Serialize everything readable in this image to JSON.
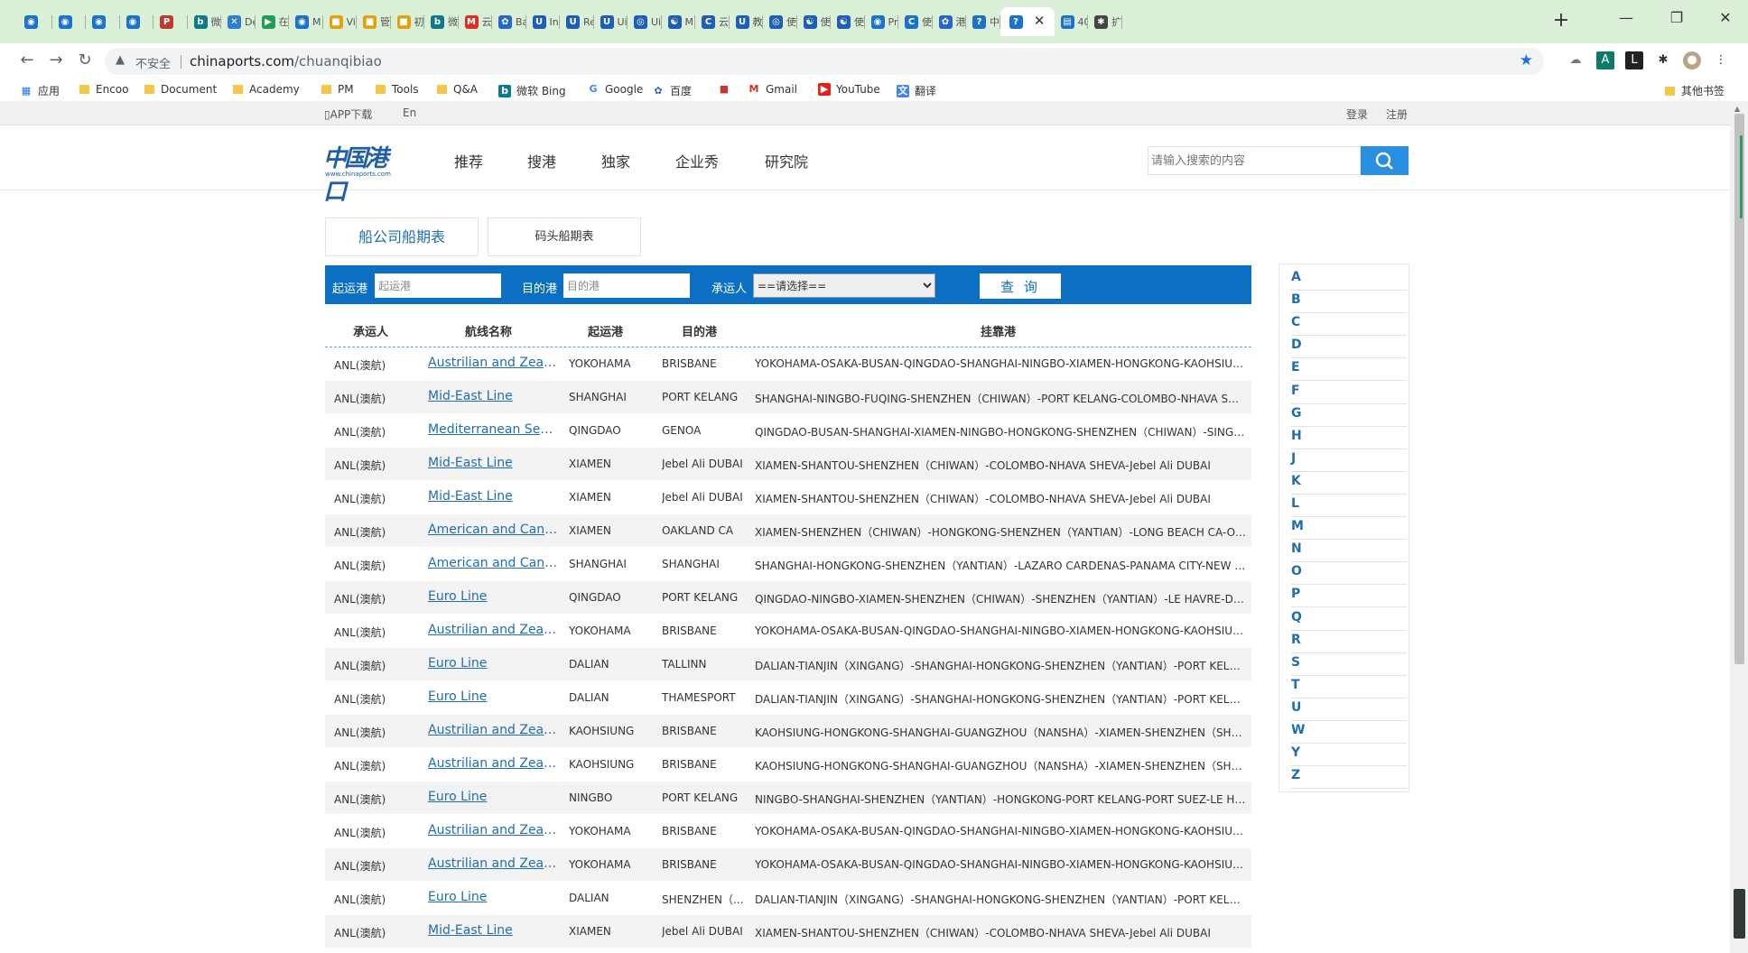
{
  "browser": {
    "tabs": [
      {
        "label": "",
        "color": "#1a73c9",
        "glyph": "◉"
      },
      {
        "label": "",
        "color": "#1a73c9",
        "glyph": "◉"
      },
      {
        "label": "",
        "color": "#1a73c9",
        "glyph": "◉"
      },
      {
        "label": "",
        "color": "#1a73c9",
        "glyph": "◉"
      },
      {
        "label": "",
        "color": "#c0392b",
        "glyph": "P"
      },
      {
        "label": "微",
        "color": "#0e7a8a",
        "glyph": "b"
      },
      {
        "label": "De",
        "color": "#2d7dd2",
        "glyph": "✕"
      },
      {
        "label": "在",
        "color": "#1e9e57",
        "glyph": "▶"
      },
      {
        "label": "M",
        "color": "#1a73c9",
        "glyph": "◉"
      },
      {
        "label": "Vi",
        "color": "#e5a00d",
        "glyph": "■"
      },
      {
        "label": "管",
        "color": "#e5a00d",
        "glyph": "■"
      },
      {
        "label": "初",
        "color": "#e5a00d",
        "glyph": "■"
      },
      {
        "label": "微",
        "color": "#0e7a8a",
        "glyph": "b"
      },
      {
        "label": "云",
        "color": "#d93025",
        "glyph": "M"
      },
      {
        "label": "Ba",
        "color": "#2468c9",
        "glyph": "✿"
      },
      {
        "label": "Ins",
        "color": "#1d5fb8",
        "glyph": "U"
      },
      {
        "label": "Re",
        "color": "#1d5fb8",
        "glyph": "U"
      },
      {
        "label": "Ui",
        "color": "#1d5fb8",
        "glyph": "U"
      },
      {
        "label": "Ui",
        "color": "#1d5fb8",
        "glyph": "◎"
      },
      {
        "label": "M",
        "color": "#1d5fb8",
        "glyph": "☯"
      },
      {
        "label": "云",
        "color": "#1d5fb8",
        "glyph": "C"
      },
      {
        "label": "教",
        "color": "#1d5fb8",
        "glyph": "U"
      },
      {
        "label": "使",
        "color": "#1d5fb8",
        "glyph": "◎"
      },
      {
        "label": "使",
        "color": "#1d5fb8",
        "glyph": "☯"
      },
      {
        "label": "使",
        "color": "#1d5fb8",
        "glyph": "☯"
      },
      {
        "label": "Pr",
        "color": "#1a73c9",
        "glyph": "◉"
      },
      {
        "label": "使",
        "color": "#1a73c9",
        "glyph": "C"
      },
      {
        "label": "港",
        "color": "#2468c9",
        "glyph": "✿"
      },
      {
        "label": "中",
        "color": "#1a73c9",
        "glyph": "?"
      },
      {
        "label": "",
        "color": "#1a73c9",
        "glyph": "?",
        "active": true
      },
      {
        "label": "40",
        "color": "#1a73c9",
        "glyph": "▤"
      },
      {
        "label": "扩",
        "color": "#444444",
        "glyph": "✱"
      }
    ],
    "address": {
      "insecure_label": "不安全",
      "host": "chinaports.com",
      "path": "/chuanqibiao"
    },
    "bookmarks": [
      {
        "label": "应用",
        "type": "apps"
      },
      {
        "label": "Encoo",
        "type": "folder"
      },
      {
        "label": "Document",
        "type": "folder"
      },
      {
        "label": "Academy",
        "type": "folder"
      },
      {
        "label": "PM",
        "type": "folder"
      },
      {
        "label": "Tools",
        "type": "folder"
      },
      {
        "label": "Q&A",
        "type": "folder"
      },
      {
        "label": "微软 Bing",
        "type": "bing"
      },
      {
        "label": "Google",
        "type": "google"
      },
      {
        "label": "百度",
        "type": "baidu"
      },
      {
        "label": "",
        "type": "flag"
      },
      {
        "label": "Gmail",
        "type": "gmail"
      },
      {
        "label": "YouTube",
        "type": "youtube"
      },
      {
        "label": "翻译",
        "type": "translate"
      }
    ],
    "other_bookmarks": "其他书签"
  },
  "topbar": {
    "app_download": "APP下载",
    "lang": "En",
    "login": "登录",
    "register": "注册"
  },
  "header": {
    "logo_text": "中国港口",
    "logo_url": "www.chinaports.com",
    "nav": [
      "推荐",
      "搜港",
      "独家",
      "企业秀",
      "研究院"
    ],
    "search_placeholder": "请输入搜索的内容"
  },
  "subtabs": [
    "船公司船期表",
    "码头船期表"
  ],
  "filter": {
    "origin_label": "起运港",
    "origin_placeholder": "起运港",
    "dest_label": "目的港",
    "dest_placeholder": "目的港",
    "carrier_label": "承运人",
    "carrier_value": "==请选择==",
    "query_label": "查 询"
  },
  "table": {
    "columns": [
      "承运人",
      "航线名称",
      "起运港",
      "目的港",
      "挂靠港"
    ],
    "rows": [
      [
        "ANL(澳航)",
        "Austrilian and Zealand Line",
        "YOKOHAMA",
        "BRISBANE",
        "YOKOHAMA-OSAKA-BUSAN-QINGDAO-SHANGHAI-NINGBO-XIAMEN-HONGKONG-KAOHSIUNG"
      ],
      [
        "ANL(澳航)",
        "Mid-East Line",
        "SHANGHAI",
        "PORT KELANG",
        "SHANGHAI-NINGBO-FUQING-SHENZHEN（CHIWAN）-PORT KELANG-COLOMBO-NHAVA SHEVA"
      ],
      [
        "ANL(澳航)",
        "Mediterranean Sea Line",
        "QINGDAO",
        "GENOA",
        "QINGDAO-BUSAN-SHANGHAI-XIAMEN-NINGBO-HONGKONG-SHENZHEN（CHIWAN）-SINGAPORE"
      ],
      [
        "ANL(澳航)",
        "Mid-East Line",
        "XIAMEN",
        "Jebel Ali DUBAI",
        "XIAMEN-SHANTOU-SHENZHEN（CHIWAN）-COLOMBO-NHAVA SHEVA-Jebel Ali DUBAI"
      ],
      [
        "ANL(澳航)",
        "Mid-East Line",
        "XIAMEN",
        "Jebel Ali DUBAI",
        "XIAMEN-SHANTOU-SHENZHEN（CHIWAN）-COLOMBO-NHAVA SHEVA-Jebel Ali DUBAI"
      ],
      [
        "ANL(澳航)",
        "American and Canada Line",
        "XIAMEN",
        "OAKLAND CA",
        "XIAMEN-SHENZHEN（CHIWAN）-HONGKONG-SHENZHEN（YANTIAN）-LONG BEACH CA-OAKLAND CA"
      ],
      [
        "ANL(澳航)",
        "American and Canada Line",
        "SHANGHAI",
        "SHANGHAI",
        "SHANGHAI-HONGKONG-SHENZHEN（YANTIAN）-LAZARO CARDENAS-PANAMA CITY-NEW YORK"
      ],
      [
        "ANL(澳航)",
        "Euro Line",
        "QINGDAO",
        "PORT KELANG",
        "QINGDAO-NINGBO-XIAMEN-SHENZHEN（CHIWAN）-SHENZHEN（YANTIAN）-LE HAVRE-DUNKIRK"
      ],
      [
        "ANL(澳航)",
        "Austrilian and Zealand Line",
        "YOKOHAMA",
        "BRISBANE",
        "YOKOHAMA-OSAKA-BUSAN-QINGDAO-SHANGHAI-NINGBO-XIAMEN-HONGKONG-KAOHSIUNG"
      ],
      [
        "ANL(澳航)",
        "Euro Line",
        "DALIAN",
        "TALLINN",
        "DALIAN-TIANJIN（XINGANG）-SHANGHAI-HONGKONG-SHENZHEN（YANTIAN）-PORT KELANG"
      ],
      [
        "ANL(澳航)",
        "Euro Line",
        "DALIAN",
        "THAMESPORT",
        "DALIAN-TIANJIN（XINGANG）-SHANGHAI-HONGKONG-SHENZHEN（YANTIAN）-PORT KELANG"
      ],
      [
        "ANL(澳航)",
        "Austrilian and Zealand Line",
        "KAOHSIUNG",
        "BRISBANE",
        "KAOHSIUNG-HONGKONG-SHANGHAI-GUANGZHOU（NANSHA）-XIAMEN-SHENZHEN（SHEKOU）"
      ],
      [
        "ANL(澳航)",
        "Austrilian and Zealand Line",
        "KAOHSIUNG",
        "BRISBANE",
        "KAOHSIUNG-HONGKONG-SHANGHAI-GUANGZHOU（NANSHA）-XIAMEN-SHENZHEN（SHEKOU）"
      ],
      [
        "ANL(澳航)",
        "Euro Line",
        "NINGBO",
        "PORT KELANG",
        "NINGBO-SHANGHAI-SHENZHEN（YANTIAN）-HONGKONG-PORT KELANG-PORT SUEZ-LE HAVRE"
      ],
      [
        "ANL(澳航)",
        "Austrilian and Zealand Line",
        "YOKOHAMA",
        "BRISBANE",
        "YOKOHAMA-OSAKA-BUSAN-QINGDAO-SHANGHAI-NINGBO-XIAMEN-HONGKONG-KAOHSIUNG"
      ],
      [
        "ANL(澳航)",
        "Austrilian and Zealand Line",
        "YOKOHAMA",
        "BRISBANE",
        "YOKOHAMA-OSAKA-BUSAN-QINGDAO-SHANGHAI-NINGBO-XIAMEN-HONGKONG-KAOHSIUNG"
      ],
      [
        "ANL(澳航)",
        "Euro Line",
        "DALIAN",
        "SHENZHEN（...",
        "DALIAN-TIANJIN（XINGANG）-SHANGHAI-HONGKONG-SHENZHEN（YANTIAN）-PORT KELANG"
      ],
      [
        "ANL(澳航)",
        "Mid-East Line",
        "XIAMEN",
        "Jebel Ali DUBAI",
        "XIAMEN-SHANTOU-SHENZHEN（CHIWAN）-COLOMBO-NHAVA SHEVA-Jebel Ali DUBAI"
      ]
    ]
  },
  "letter_index": [
    "A",
    "B",
    "C",
    "D",
    "E",
    "F",
    "G",
    "H",
    "J",
    "K",
    "L",
    "M",
    "N",
    "O",
    "P",
    "Q",
    "R",
    "S",
    "T",
    "U",
    "W",
    "Y",
    "Z"
  ]
}
